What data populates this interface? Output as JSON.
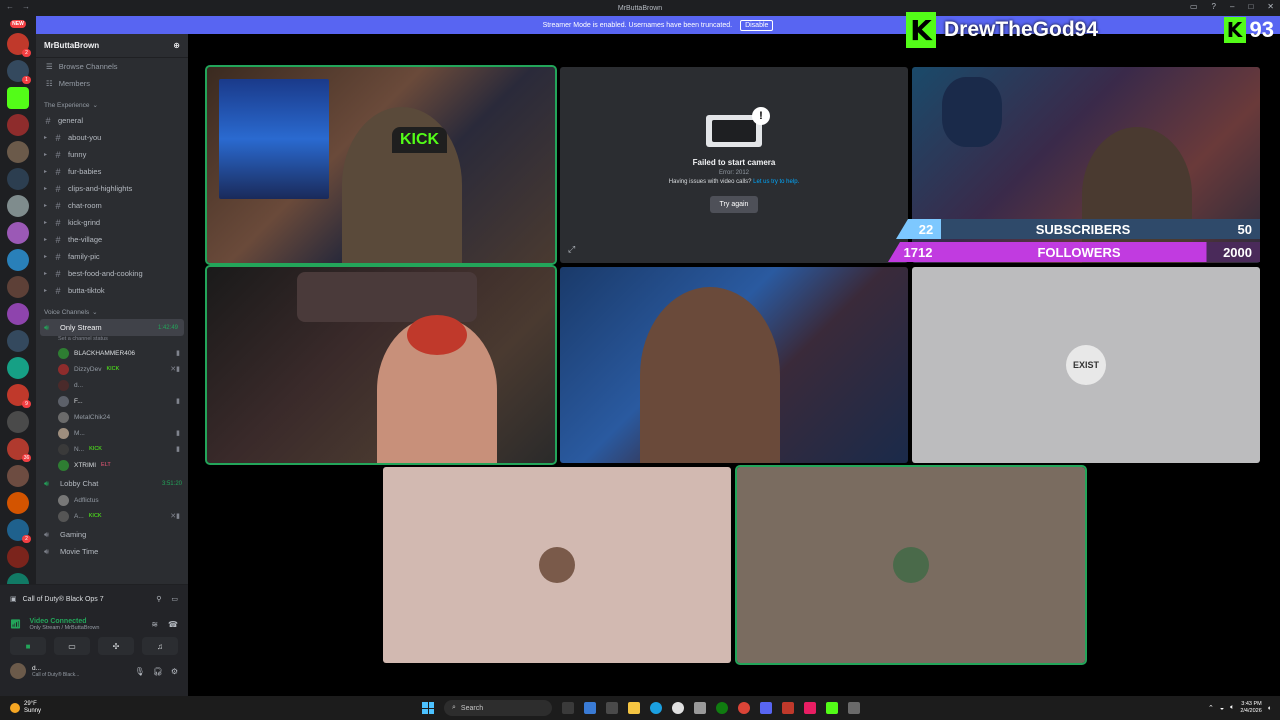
{
  "window": {
    "title": "MrButtaBrown"
  },
  "banner": {
    "text": "Streamer Mode is enabled. Usernames have been truncated.",
    "disable_label": "Disable"
  },
  "server_rail": {
    "new_label": "NEW",
    "badges": [
      "2",
      "1",
      "9",
      "36",
      "2"
    ]
  },
  "sidebar": {
    "server_name": "MrButtaBrown",
    "nav": [
      "Browse Channels",
      "Members"
    ],
    "text_category": "The Experience",
    "channels": [
      "general",
      "about-you",
      "funny",
      "fur-babies",
      "clips-and-highlights",
      "chat-room",
      "kick-grind",
      "the-village",
      "family-pic",
      "best-food-and-cooking",
      "butta-tiktok"
    ],
    "voice_category": "Voice Channels",
    "only_stream": {
      "name": "Only Stream",
      "time": "1:42:49",
      "status": "Set a channel status",
      "users": [
        {
          "name": "BLACKHAMMER406",
          "tag": ""
        },
        {
          "name": "DizzyDev",
          "tag": "KICK"
        },
        {
          "name": "d...",
          "tag": ""
        },
        {
          "name": "F...",
          "tag": ""
        },
        {
          "name": "MetalChik24",
          "tag": ""
        },
        {
          "name": "M...",
          "tag": ""
        },
        {
          "name": "N...",
          "tag": "KICK"
        },
        {
          "name": "XTRIMI",
          "tag": "ELT"
        }
      ]
    },
    "lobby_chat": {
      "name": "Lobby Chat",
      "time": "3:51:20",
      "users": [
        {
          "name": "Adflictus",
          "tag": ""
        },
        {
          "name": "A...",
          "tag": "KICK"
        }
      ]
    },
    "other_voice": [
      "Gaming",
      "Movie Time"
    ]
  },
  "voice_panel": {
    "activity": "Call of Duty® Black Ops 7",
    "connected_title": "Video Connected",
    "connected_sub": "Only Stream / MrButtaBrown",
    "user_name": "d...",
    "user_status": "Call of Duty® Black..."
  },
  "tiles": {
    "failed": {
      "title": "Failed to start camera",
      "error": "Error: 2012",
      "help_prefix": "Having issues with video calls?",
      "help_link": "Let us try to help.",
      "try_again": "Try again"
    },
    "logo_text": "EXIST",
    "kick_cap": "KICK"
  },
  "overlay": {
    "kick_glyph": "K",
    "channel_name": "DrewTheGod94",
    "count": "93",
    "subscribers": {
      "current": "22",
      "label": "SUBSCRIBERS",
      "target": "50",
      "progress": 0.44
    },
    "followers": {
      "current": "1712",
      "label": "FOLLOWERS",
      "target": "2000",
      "progress": 0.856
    }
  },
  "taskbar": {
    "temp": "29°F",
    "weather": "Sunny",
    "search": "Search",
    "time": "3:43 PM",
    "date": "2/4/2026"
  },
  "colors": {
    "discord_blurple": "#5865f2",
    "speaking_green": "#23a55a",
    "kick_green": "#53fc18"
  }
}
